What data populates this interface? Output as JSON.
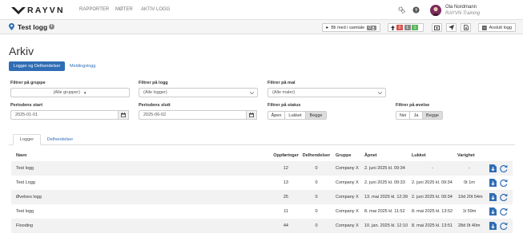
{
  "app": {
    "brand": "RAYVN",
    "nav": [
      "RAPPORTER",
      "MØTER",
      "AKTIV LOGG"
    ],
    "user_name": "Ola Nordmann",
    "user_org": "RAYVN Training"
  },
  "log_bar": {
    "title": "Test logg",
    "join_call_label": "Bli med i samtale",
    "call_count": "0",
    "status_counts": [
      "0",
      "1",
      "1"
    ],
    "end_log_label": "Avslutt logg"
  },
  "page": {
    "heading": "Arkiv",
    "tabs": [
      "Logger og Delhendelser",
      "Meldingslogg"
    ]
  },
  "filters": {
    "group_label": "Filtrer på gruppe",
    "group_value": "(Alle grupper)",
    "log_label": "Filtrer på logg",
    "log_value": "(Alle logger)",
    "template_label": "Filtrer på mal",
    "template_value": "(Alle maler)",
    "start_label": "Periodens start",
    "start_value": "2025-01-01",
    "end_label": "Periodens slutt",
    "end_value": "2025-06-02",
    "status_label": "Filtrer på status",
    "status_options": [
      "Åpen",
      "Lukket",
      "Begge"
    ],
    "status_selected": "Begge",
    "exercise_label": "Filtrer på øvelse",
    "exercise_options": [
      "Nei",
      "Ja",
      "Begge"
    ],
    "exercise_selected": "Begge"
  },
  "table_tabs": [
    "Logger",
    "Delhendelser"
  ],
  "table": {
    "columns": [
      "Navn",
      "Oppføringer",
      "Delhendelser",
      "Gruppe",
      "Åpnet",
      "Lukket",
      "Varighet"
    ],
    "rows": [
      [
        "Test logg",
        "12",
        "0",
        "Company X",
        "2. juni 2025 kl. 09:34",
        "-",
        "-"
      ],
      [
        "Test Logg",
        "13",
        "0",
        "Company X",
        "2. juni 2025 kl. 09:33",
        "2. juni 2025 kl. 09:34",
        "0t 1m"
      ],
      [
        "Øvelses logg",
        "25",
        "0",
        "Company X",
        "13. mai 2025 kl. 12:39",
        "2. juni 2025 kl. 09:34",
        "19d 20t 54m"
      ],
      [
        "Test logg",
        "11",
        "0",
        "Company X",
        "8. mai 2025 kl. 11:52",
        "8. mai 2025 kl. 13:52",
        "1t 59m"
      ],
      [
        "Flooding",
        "44",
        "0",
        "Company X",
        "10. jan. 2025 kl. 12:10",
        "8. mai 2025 kl. 13:51",
        "28d 0t 40m"
      ]
    ]
  },
  "colors": {
    "accent": "#2f6db5",
    "call_badge": "#888888",
    "status_red": "#d9534f",
    "status_gray": "#8a8a8a",
    "status_green": "#5cb85c"
  }
}
